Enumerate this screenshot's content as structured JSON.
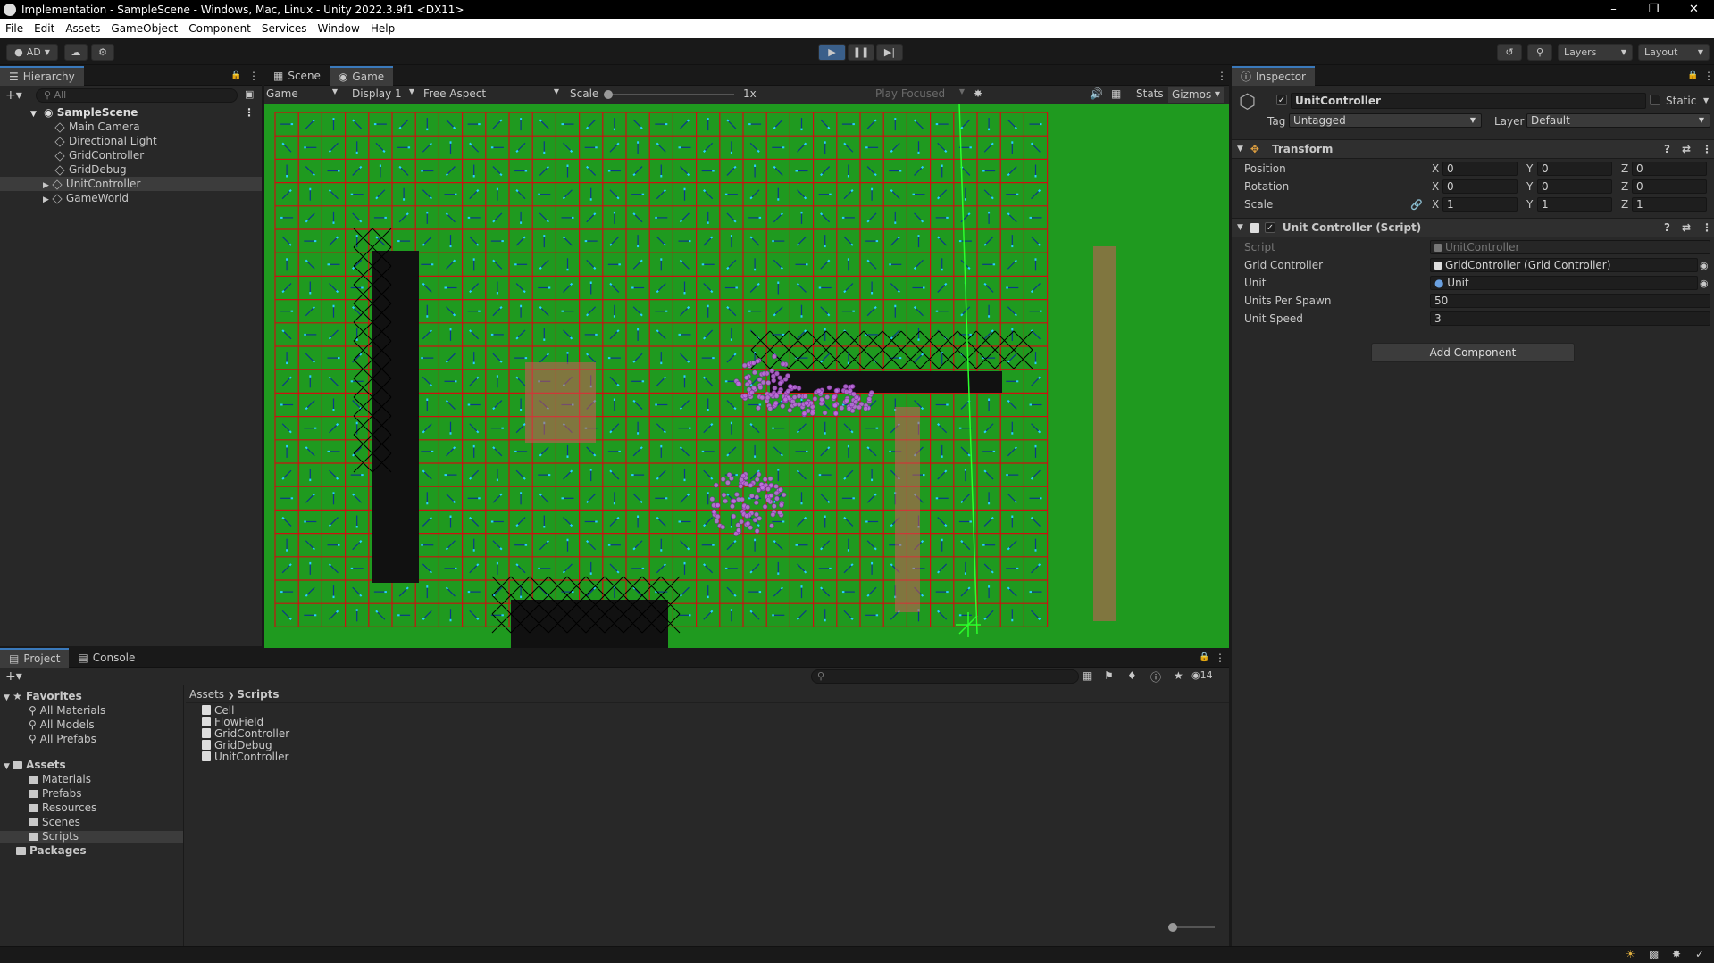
{
  "window": {
    "title": "Implementation - SampleScene - Windows, Mac, Linux - Unity 2022.3.9f1 <DX11>"
  },
  "menu": [
    "File",
    "Edit",
    "Assets",
    "GameObject",
    "Component",
    "Services",
    "Window",
    "Help"
  ],
  "toolbar": {
    "account": "AD",
    "layers": "Layers",
    "layout": "Layout"
  },
  "hierarchy": {
    "tab": "Hierarchy",
    "search_placeholder": "All",
    "scene": "SampleScene",
    "items": [
      {
        "label": "Main Camera"
      },
      {
        "label": "Directional Light"
      },
      {
        "label": "GridController"
      },
      {
        "label": "GridDebug"
      },
      {
        "label": "UnitController"
      },
      {
        "label": "GameWorld"
      }
    ]
  },
  "game": {
    "tabs": [
      "Scene",
      "Game"
    ],
    "mode": "Game",
    "display": "Display 1",
    "aspect": "Free Aspect",
    "scale_label": "Scale",
    "scale_value": "1x",
    "play_focused": "Play Focused",
    "stats": "Stats",
    "gizmos": "Gizmos",
    "colors": {
      "ground": "#1f9a1f",
      "grid": "#cc1111",
      "arrow": "#0a3a8a",
      "obstacle": "#111111"
    }
  },
  "inspector": {
    "tab": "Inspector",
    "object_name": "UnitController",
    "static_label": "Static",
    "tag_label": "Tag",
    "tag_value": "Untagged",
    "layer_label": "Layer",
    "layer_value": "Default",
    "transform": {
      "title": "Transform",
      "position_label": "Position",
      "rotation_label": "Rotation",
      "scale_label": "Scale",
      "position": {
        "x": "0",
        "y": "0",
        "z": "0"
      },
      "rotation": {
        "x": "0",
        "y": "0",
        "z": "0"
      },
      "scale": {
        "x": "1",
        "y": "1",
        "z": "1"
      }
    },
    "script_component": {
      "title": "Unit Controller (Script)",
      "script_label": "Script",
      "script_value": "UnitController",
      "grid_label": "Grid Controller",
      "grid_value": "GridController (Grid Controller)",
      "unit_label": "Unit",
      "unit_value": "Unit",
      "units_per_spawn_label": "Units Per Spawn",
      "units_per_spawn": "50",
      "unit_speed_label": "Unit Speed",
      "unit_speed": "3"
    },
    "add_component": "Add Component"
  },
  "project": {
    "tabs": [
      "Project",
      "Console"
    ],
    "hidden_count": "14",
    "favorites_label": "Favorites",
    "favorites": [
      "All Materials",
      "All Models",
      "All Prefabs"
    ],
    "assets_label": "Assets",
    "folders": [
      "Materials",
      "Prefabs",
      "Resources",
      "Scenes",
      "Scripts"
    ],
    "packages_label": "Packages",
    "breadcrumb": [
      "Assets",
      "Scripts"
    ],
    "files": [
      "Cell",
      "FlowField",
      "GridController",
      "GridDebug",
      "UnitController"
    ]
  }
}
